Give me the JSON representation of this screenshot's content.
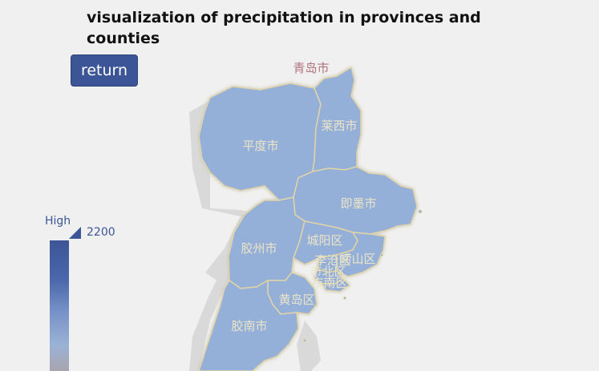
{
  "header": {
    "title": "visualization of precipitation in provinces and counties"
  },
  "controls": {
    "return_label": "return"
  },
  "map": {
    "city_label": "青岛市",
    "region_color": "#94b0d8",
    "border_color": "#e2d4a6",
    "label_color": "#ece4c8",
    "regions": [
      {
        "name": "平度市"
      },
      {
        "name": "莱西市"
      },
      {
        "name": "即墨市"
      },
      {
        "name": "胶州市"
      },
      {
        "name": "城阳区"
      },
      {
        "name": "崂山区"
      },
      {
        "name": "李沧区"
      },
      {
        "name": "市北区"
      },
      {
        "name": "市南区"
      },
      {
        "name": "黄岛区"
      },
      {
        "name": "胶南市"
      }
    ]
  },
  "legend": {
    "high_label": "High",
    "max_value": "2200",
    "colors": [
      "#3c5596",
      "#7792c8",
      "#a9a4ae"
    ]
  }
}
